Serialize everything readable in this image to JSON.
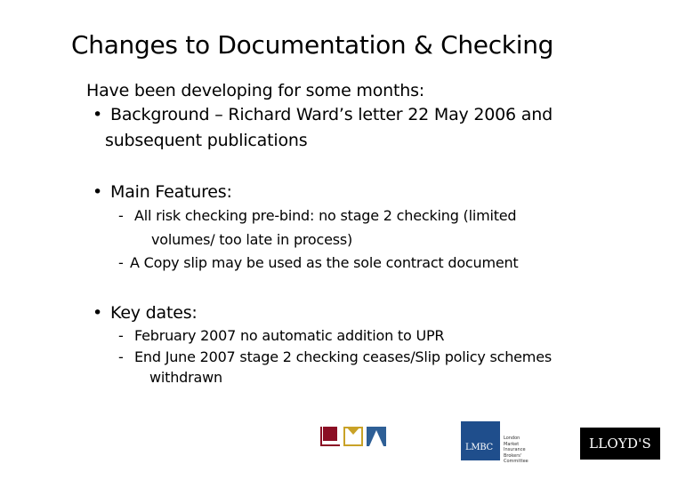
{
  "slide": {
    "title": "Changes to Documentation & Checking",
    "intro": "Have been developing for some months:",
    "bullets": [
      {
        "marker": "•",
        "text_lines": [
          "Background – Richard Ward’s letter 22 May 2006 and",
          "subsequent publications"
        ]
      },
      {
        "marker": "•",
        "text": "Main Features:",
        "sub_items": [
          {
            "marker": "-",
            "text_lines": [
              "All risk checking pre-bind: no stage 2 checking (limited",
              "volumes/ too late in process)"
            ]
          },
          {
            "marker": "-",
            "text_lines": [
              "A Copy slip may be used as the sole contract document"
            ]
          }
        ]
      },
      {
        "marker": "•",
        "text": "Key dates:",
        "sub_items": [
          {
            "marker": "-",
            "text_lines": [
              "February 2007 no automatic addition to UPR"
            ]
          },
          {
            "marker": "-",
            "text_lines": [
              "End June 2007 stage 2 checking ceases/Slip policy schemes",
              "withdrawn"
            ]
          }
        ]
      }
    ]
  },
  "logos": {
    "lma": {
      "name": "LMA logo",
      "colors": [
        "#8b0e24",
        "#c9a227",
        "#2e5f96"
      ]
    },
    "lmbc": {
      "label": "LMBC",
      "caption": "London\nMarket\nInsurance\nBrokers'\nCommittee",
      "color": "#1f4e8c"
    },
    "lloyds": {
      "label": "LLOYD'S",
      "color": "#000000"
    }
  }
}
